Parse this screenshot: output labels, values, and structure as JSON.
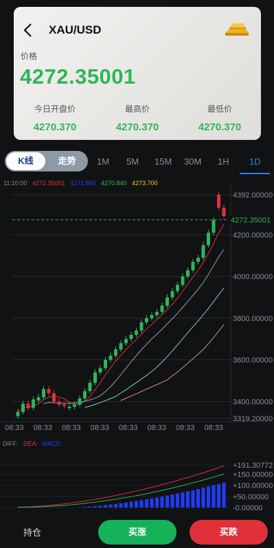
{
  "header": {
    "symbol": "XAU/USD",
    "price_label": "价格",
    "price": "4272.35001",
    "stats": [
      {
        "label": "今日开盘价",
        "value": "4270.370"
      },
      {
        "label": "最高价",
        "value": "4270.370"
      },
      {
        "label": "最低价",
        "value": "4270.370"
      }
    ]
  },
  "tabs": {
    "segments": [
      "K线",
      "走势"
    ],
    "timeframes": [
      "1M",
      "5M",
      "15M",
      "30M",
      "1H",
      "1D"
    ],
    "active_timeframe": "1D"
  },
  "indicator_row": {
    "time": "11:10:00",
    "values": [
      {
        "text": "4272.35001",
        "color": "#e0313a"
      },
      {
        "text": "4271.860",
        "color": "#1e3cff"
      },
      {
        "text": "4270.840",
        "color": "#2fb55a"
      },
      {
        "text": "4273.700",
        "color": "#f5d020"
      }
    ]
  },
  "chart_data": {
    "type": "candlestick",
    "y_ticks": [
      "4392.00000",
      "4200.00000",
      "4000.00000",
      "3800.00000",
      "3600.00000",
      "3400.00000",
      "3319.20000"
    ],
    "current_price_label": "4272.35001",
    "x_ticks": [
      "08:33",
      "08:33",
      "08:33",
      "08:33",
      "08:33",
      "08:33",
      "08:33",
      "08:33"
    ],
    "candles_close": [
      3350,
      3390,
      3370,
      3410,
      3420,
      3460,
      3440,
      3400,
      3385,
      3380,
      3375,
      3385,
      3415,
      3450,
      3490,
      3540,
      3560,
      3600,
      3620,
      3650,
      3680,
      3700,
      3720,
      3740,
      3780,
      3800,
      3815,
      3830,
      3860,
      3900,
      3930,
      3960,
      4000,
      4030,
      4070,
      4090,
      4150,
      4210,
      4270,
      4330,
      4290
    ],
    "candles_open": [
      3330,
      3350,
      3390,
      3370,
      3405,
      3420,
      3460,
      3440,
      3400,
      3385,
      3370,
      3375,
      3385,
      3415,
      3450,
      3490,
      3540,
      3560,
      3600,
      3620,
      3650,
      3680,
      3700,
      3720,
      3740,
      3780,
      3800,
      3815,
      3830,
      3860,
      3900,
      3930,
      3960,
      4000,
      4030,
      4070,
      4090,
      4150,
      4210,
      4392,
      4330
    ],
    "macd": {
      "labels": [
        "DIFF:",
        "DEA:",
        "MACD:"
      ],
      "label_colors": [
        "#888888",
        "#e0313a",
        "#1e3cff"
      ],
      "y_ticks": [
        "+191.30772",
        "+150.00000",
        "+100.00000",
        "+50.00000",
        "-0.00000"
      ]
    }
  },
  "footer": {
    "hold_label": "持仓",
    "buy_label": "买涨",
    "sell_label": "买跌"
  },
  "colors": {
    "up": "#2fb55a",
    "down": "#e0313a",
    "accent": "#2f80ed"
  },
  "icons": [
    "back-arrow-icon",
    "gold-bar-icon"
  ]
}
